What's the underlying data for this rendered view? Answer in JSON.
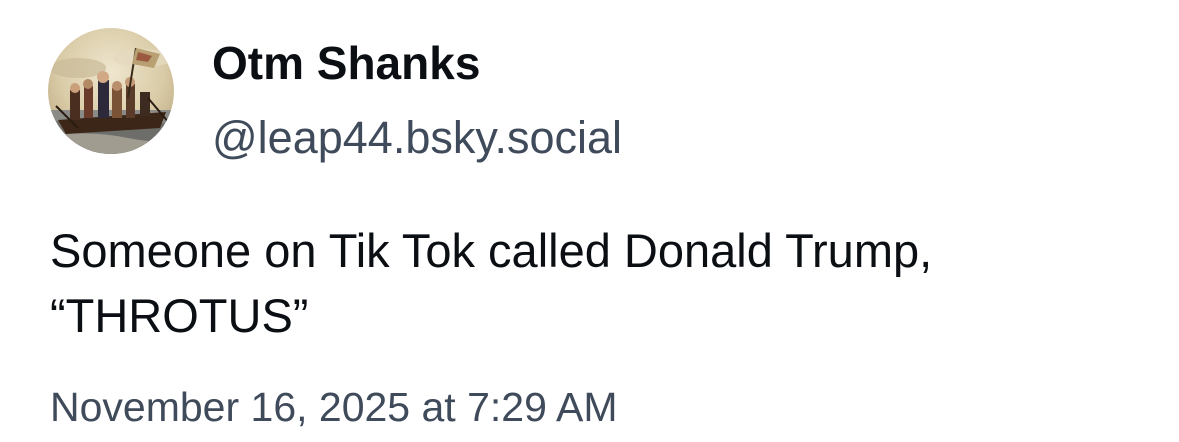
{
  "author": {
    "display_name": "Otm Shanks",
    "handle": "@leap44.bsky.social",
    "avatar_icon": "painting-avatar"
  },
  "post": {
    "lines": [
      "Someone on Tik Tok called Donald Trump,",
      "“THROTUS”"
    ]
  },
  "timestamp": "November 16, 2025 at 7:29 AM",
  "colors": {
    "primary_text": "#0b0f14",
    "secondary_text": "#3f4a5a",
    "background": "#ffffff"
  }
}
